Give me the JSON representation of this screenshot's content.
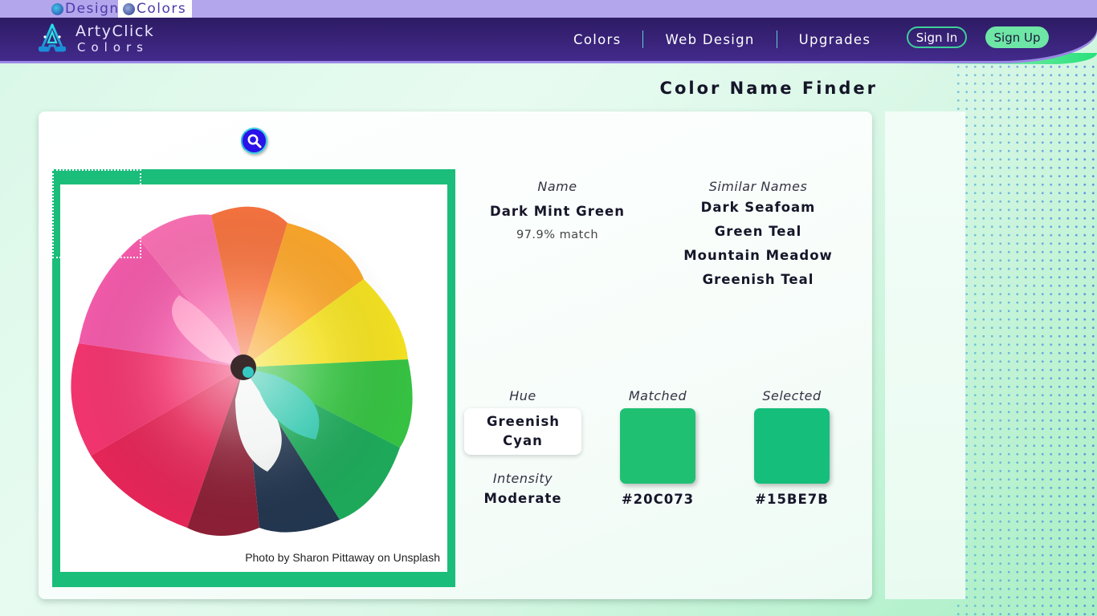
{
  "site_switcher": {
    "tabs": [
      {
        "label": "Design",
        "icon": "artyclick-design-logo-icon",
        "active": false
      },
      {
        "label": "Colors",
        "icon": "artyclick-colors-logo-icon",
        "active": true
      }
    ]
  },
  "navbar": {
    "brand_name": "ArtyClick",
    "brand_sub": "Colors",
    "links": [
      "Colors",
      "Web Design",
      "Upgrades"
    ],
    "sign_in": "Sign In",
    "sign_up": "Sign Up"
  },
  "page": {
    "title": "Color Name Finder"
  },
  "finder": {
    "search_icon": "magnifier-icon",
    "photo_credit": "Photo by Sharon Pittaway on Unsplash",
    "frame_color": "#1BBD7A",
    "name_label": "Name",
    "name_value": "Dark Mint Green",
    "match_text": "97.9% match",
    "similar_label": "Similar Names",
    "similar_names": [
      "Dark Seafoam",
      "Green Teal",
      "Mountain Meadow",
      "Greenish Teal"
    ],
    "hue_label": "Hue",
    "hue_value": "Greenish Cyan",
    "intensity_label": "Intensity",
    "intensity_value": "Moderate",
    "matched_label": "Matched",
    "matched_hex": "#20C073",
    "selected_label": "Selected",
    "selected_hex": "#15BE7B"
  }
}
